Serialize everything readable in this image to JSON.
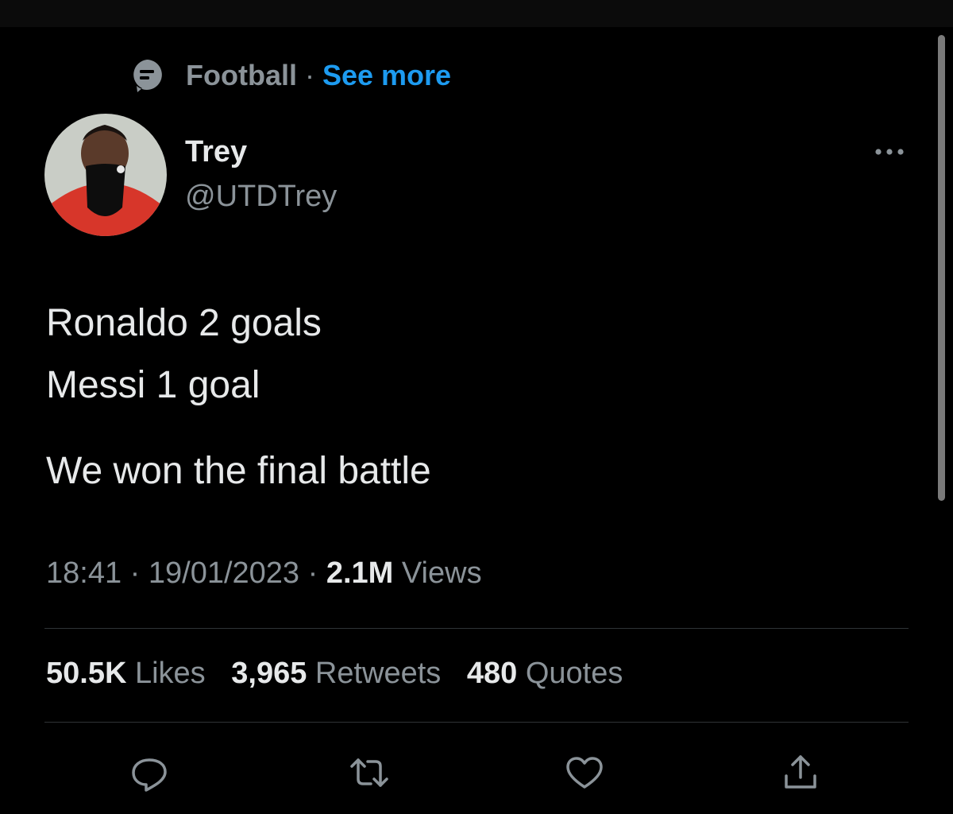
{
  "topic": {
    "icon": "topic-icon",
    "name": "Football",
    "separator": "·",
    "see_more": "See more"
  },
  "author": {
    "display_name": "Trey",
    "handle": "@UTDTrey",
    "avatar": "avatar-photo"
  },
  "more_icon": "more-options-icon",
  "tweet": {
    "lines": [
      "Ronaldo 2 goals",
      "Messi 1 goal"
    ],
    "closing_line": "We won the final battle"
  },
  "meta": {
    "time": "18:41",
    "date": "19/01/2023",
    "separator": "·",
    "views_count": "2.1M",
    "views_label": "Views"
  },
  "stats": {
    "likes_count": "50.5K",
    "likes_label": "Likes",
    "retweets_count": "3,965",
    "retweets_label": "Retweets",
    "quotes_count": "480",
    "quotes_label": "Quotes"
  },
  "actions": [
    {
      "name": "reply",
      "icon": "reply-icon"
    },
    {
      "name": "retweet",
      "icon": "retweet-icon"
    },
    {
      "name": "like",
      "icon": "heart-icon"
    },
    {
      "name": "share",
      "icon": "share-icon"
    }
  ],
  "colors": {
    "background": "#000000",
    "text": "#e7e9ea",
    "secondary": "#8b9399",
    "link": "#1d9bf0",
    "divider": "#2f3336"
  }
}
